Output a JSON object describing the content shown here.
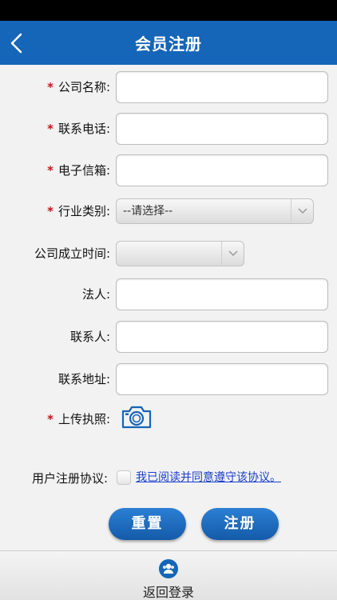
{
  "header": {
    "title": "会员注册"
  },
  "form": {
    "required_mark": "*",
    "fields": {
      "company_name": {
        "label": "公司名称:",
        "value": "",
        "required": true
      },
      "phone": {
        "label": "联系电话:",
        "value": "",
        "required": true
      },
      "email": {
        "label": "电子信箱:",
        "value": "",
        "required": true
      },
      "industry": {
        "label": "行业类别:",
        "value": "--请选择--",
        "required": true
      },
      "founded": {
        "label": "公司成立时间:",
        "value": "",
        "required": false
      },
      "legal_person": {
        "label": "法人:",
        "value": "",
        "required": false
      },
      "contact_person": {
        "label": "联系人:",
        "value": "",
        "required": false
      },
      "address": {
        "label": "联系地址:",
        "value": "",
        "required": false
      },
      "license": {
        "label": "上传执照:",
        "required": true,
        "icon": "camera-icon"
      }
    },
    "agreement": {
      "label": "用户注册协议:",
      "link_text": "我已阅读并同意遵守该协议。",
      "checked": false
    },
    "buttons": {
      "reset": "重置",
      "submit": "注册"
    }
  },
  "footer": {
    "back_login": "返回登录",
    "icon": "user-group-icon"
  },
  "colors": {
    "nav_bar": "#1565b8",
    "required": "#c8141e",
    "link": "#1a3fcc",
    "button": "#1d6cc4"
  }
}
